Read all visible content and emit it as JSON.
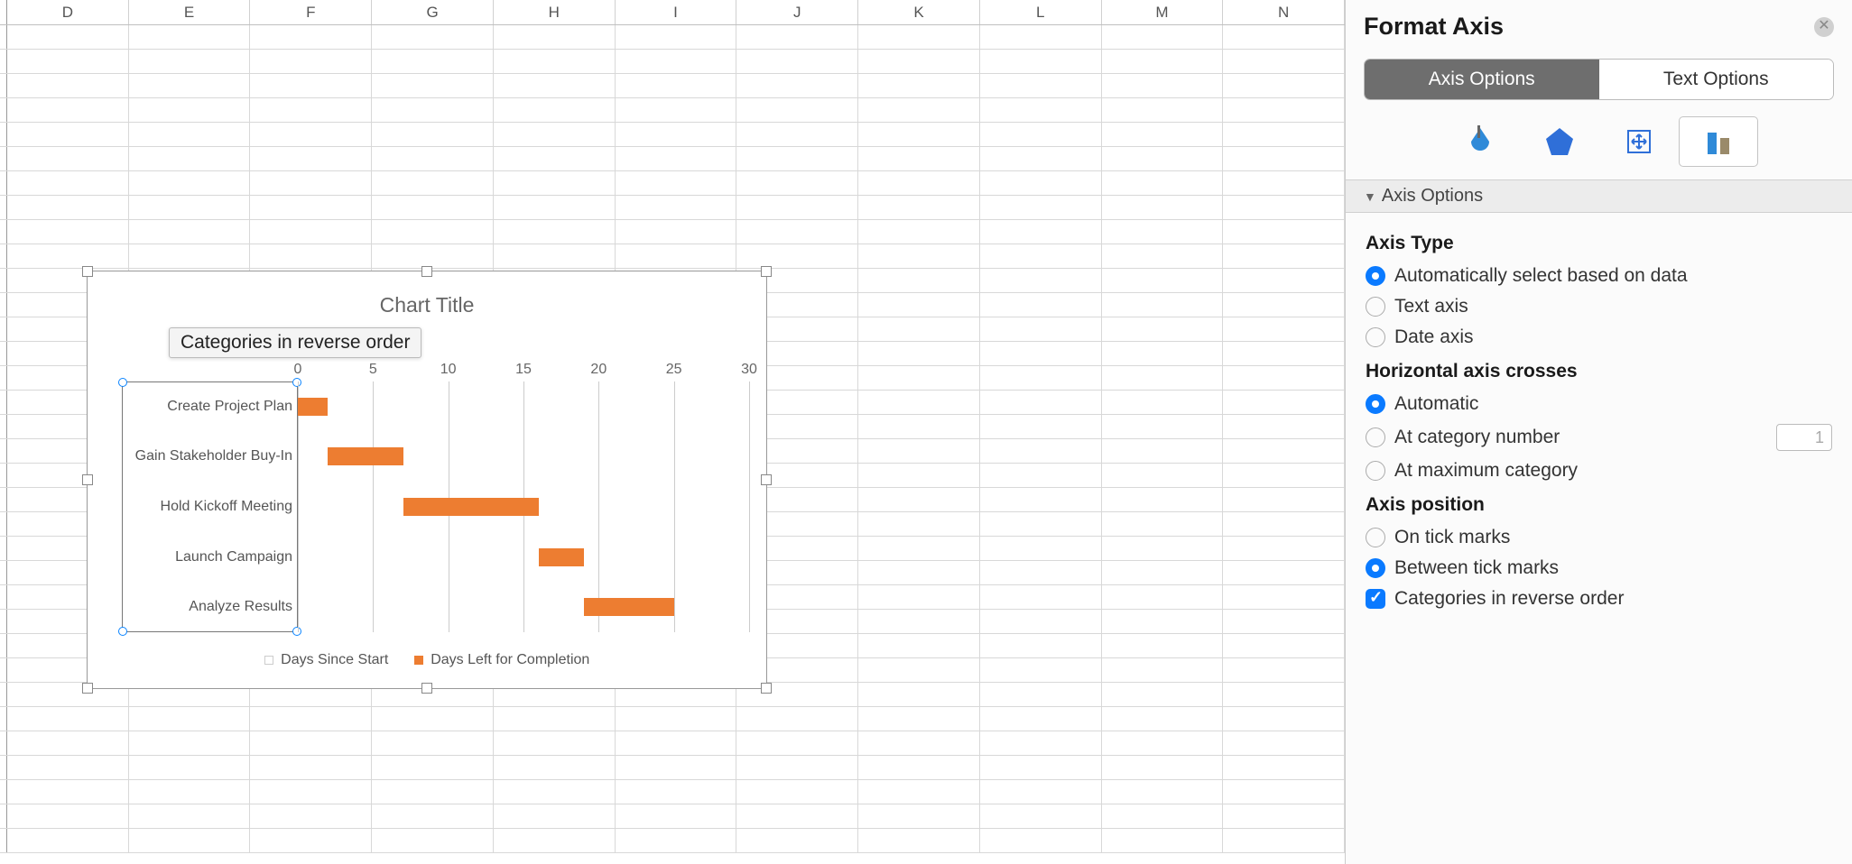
{
  "columns": [
    "D",
    "E",
    "F",
    "G",
    "H",
    "I",
    "J",
    "K",
    "L",
    "M",
    "N"
  ],
  "sidebar": {
    "title": "Format Axis",
    "tabs": {
      "axis_options": "Axis Options",
      "text_options": "Text Options"
    },
    "section_label": "Axis Options",
    "axis_type": {
      "title": "Axis Type",
      "auto": "Automatically select based on data",
      "text": "Text axis",
      "date": "Date axis"
    },
    "crosses": {
      "title": "Horizontal axis crosses",
      "automatic": "Automatic",
      "at_category": "At category number",
      "at_category_value": "1",
      "at_max": "At maximum category"
    },
    "position": {
      "title": "Axis position",
      "on_tick": "On tick marks",
      "between_tick": "Between tick marks",
      "reverse": "Categories in reverse order"
    }
  },
  "chart": {
    "title": "Chart Title",
    "tooltip": "Categories in reverse order",
    "legend": {
      "series1": "Days Since Start",
      "series2": "Days Left for Completion"
    }
  },
  "chart_data": {
    "type": "bar",
    "orientation": "horizontal",
    "stacked": true,
    "title": "Chart Title",
    "categories": [
      "Create Project Plan",
      "Gain Stakeholder Buy-In",
      "Hold Kickoff Meeting",
      "Launch Campaign",
      "Analyze Results"
    ],
    "series": [
      {
        "name": "Days Since Start",
        "values": [
          0,
          2,
          7,
          16,
          19
        ],
        "color": "transparent"
      },
      {
        "name": "Days Left for Completion",
        "values": [
          2,
          5,
          9,
          3,
          6
        ],
        "color": "#ed7d31"
      }
    ],
    "xlim": [
      0,
      30
    ],
    "xticks": [
      0,
      5,
      10,
      15,
      20,
      25,
      30
    ],
    "ylabel": "",
    "xlabel": ""
  }
}
